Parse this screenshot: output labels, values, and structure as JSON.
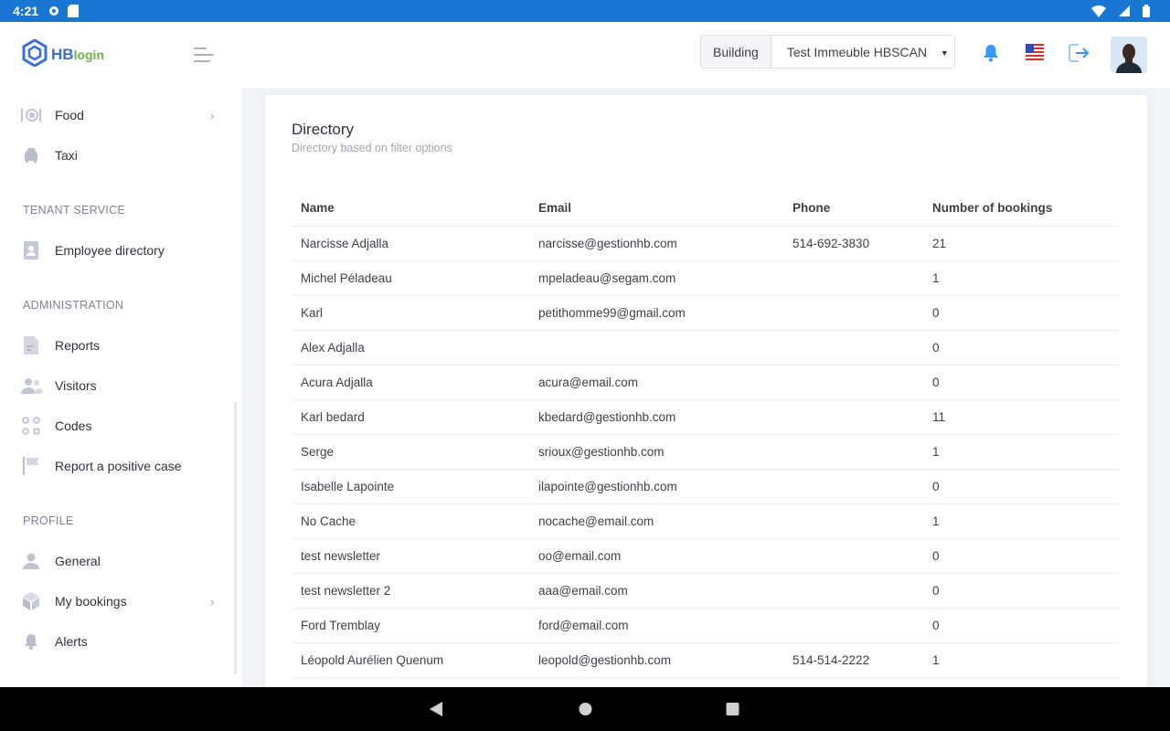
{
  "status_bar": {
    "time": "4:21",
    "icons": [
      "settings-icon",
      "sd-card-icon",
      "wifi-icon",
      "signal-icon",
      "battery-icon"
    ]
  },
  "brand": {
    "hb": "HB",
    "login": "login"
  },
  "sidebar": {
    "items_top": [
      {
        "label": "Food",
        "icon": "food-icon",
        "has_chevron": true
      },
      {
        "label": "Taxi",
        "icon": "taxi-icon",
        "has_chevron": false
      }
    ],
    "sections": [
      {
        "title": "TENANT SERVICE",
        "items": [
          {
            "label": "Employee directory",
            "icon": "contact-book-icon"
          }
        ]
      },
      {
        "title": "ADMINISTRATION",
        "items": [
          {
            "label": "Reports",
            "icon": "document-icon"
          },
          {
            "label": "Visitors",
            "icon": "users-icon"
          },
          {
            "label": "Codes",
            "icon": "codes-icon"
          },
          {
            "label": "Report a positive case",
            "icon": "flag-icon"
          }
        ]
      },
      {
        "title": "PROFILE",
        "items": [
          {
            "label": "General",
            "icon": "user-icon"
          },
          {
            "label": "My bookings",
            "icon": "box-icon"
          },
          {
            "label": "Alerts",
            "icon": "bell-icon"
          }
        ]
      }
    ]
  },
  "header": {
    "building_label": "Building",
    "building_value": "Test Immeuble HBSCAN",
    "language": "en-US"
  },
  "colors": {
    "accent": "#1976d2",
    "brand_blue": "#3b6fd6",
    "brand_green": "#6cb04a",
    "bell": "#3699ff"
  },
  "directory": {
    "title": "Directory",
    "subtitle": "Directory based on filter options",
    "columns": [
      "Name",
      "Email",
      "Phone",
      "Number of bookings"
    ],
    "rows": [
      [
        "Narcisse Adjalla",
        "narcisse@gestionhb.com",
        "514-692-3830",
        "21"
      ],
      [
        "Michel Péladeau",
        "mpeladeau@segam.com",
        "",
        "1"
      ],
      [
        "Karl",
        "petithomme99@gmail.com",
        "",
        "0"
      ],
      [
        "Alex Adjalla",
        "",
        "",
        "0"
      ],
      [
        "Acura Adjalla",
        "acura@email.com",
        "",
        "0"
      ],
      [
        "Karl bedard",
        "kbedard@gestionhb.com",
        "",
        "11"
      ],
      [
        "Serge",
        "srioux@gestionhb.com",
        "",
        "1"
      ],
      [
        "Isabelle Lapointe",
        "ilapointe@gestionhb.com",
        "",
        "0"
      ],
      [
        "No Cache",
        "nocache@email.com",
        "",
        "1"
      ],
      [
        "test newsletter",
        "oo@email.com",
        "",
        "0"
      ],
      [
        "test newsletter 2",
        "aaa@email.com",
        "",
        "0"
      ],
      [
        "Ford Tremblay",
        "ford@email.com",
        "",
        "0"
      ],
      [
        "Léopold Aurélien Quenum",
        "leopold@gestionhb.com",
        "514-514-2222",
        "1"
      ]
    ]
  }
}
